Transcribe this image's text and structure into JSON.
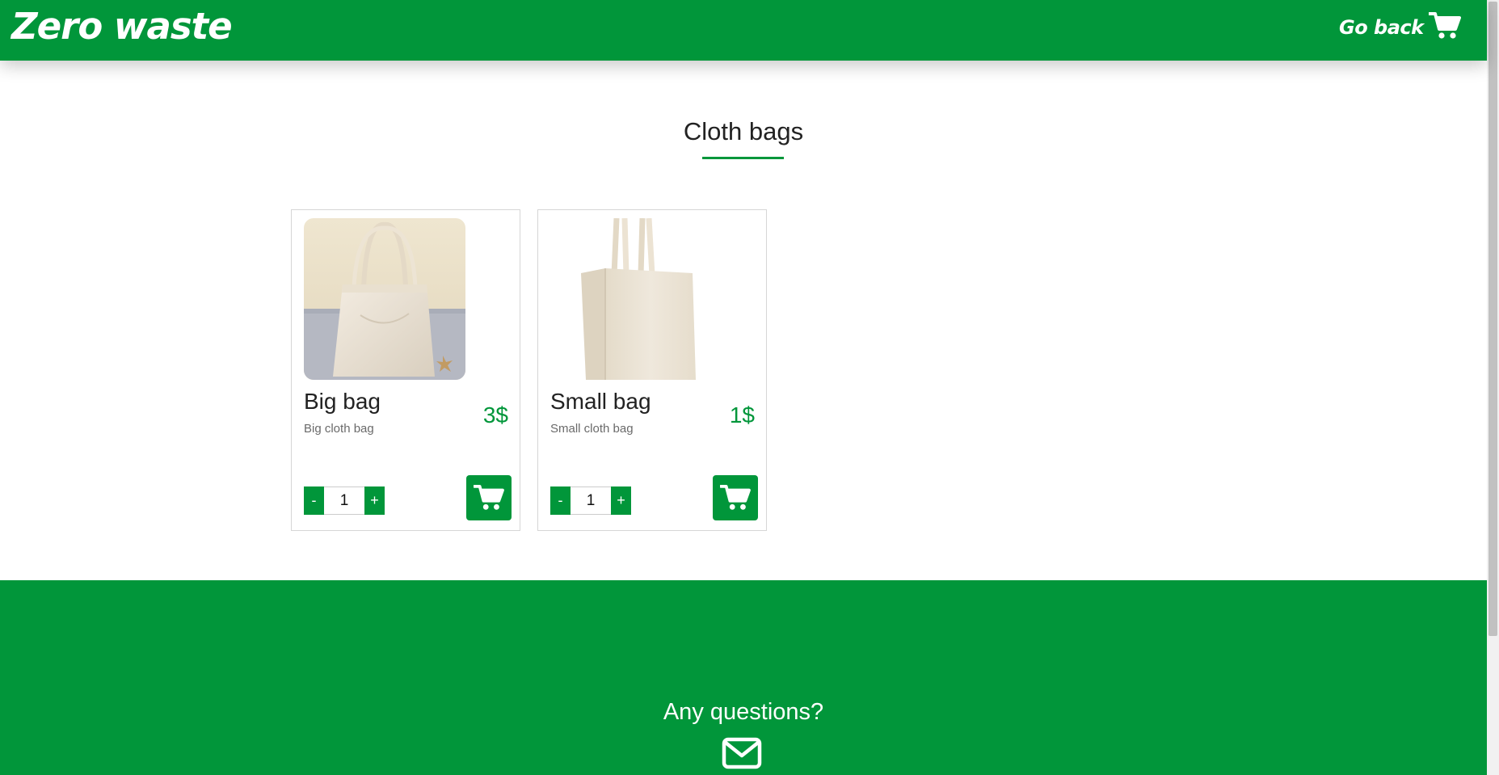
{
  "header": {
    "logo": "Zero waste",
    "go_back": "Go back",
    "cart_icon": "cart-icon"
  },
  "section": {
    "title": "Cloth bags"
  },
  "products": [
    {
      "name": "Big bag",
      "description": "Big cloth bag",
      "price": "3$",
      "quantity": "1",
      "minus": "-",
      "plus": "+"
    },
    {
      "name": "Small bag",
      "description": "Small cloth bag",
      "price": "1$",
      "quantity": "1",
      "minus": "-",
      "plus": "+"
    }
  ],
  "footer": {
    "question": "Any questions?",
    "mail_icon": "envelope-icon"
  },
  "colors": {
    "brand_green": "#01963a",
    "text_dark": "#222222",
    "text_muted": "#6a6a6a"
  }
}
